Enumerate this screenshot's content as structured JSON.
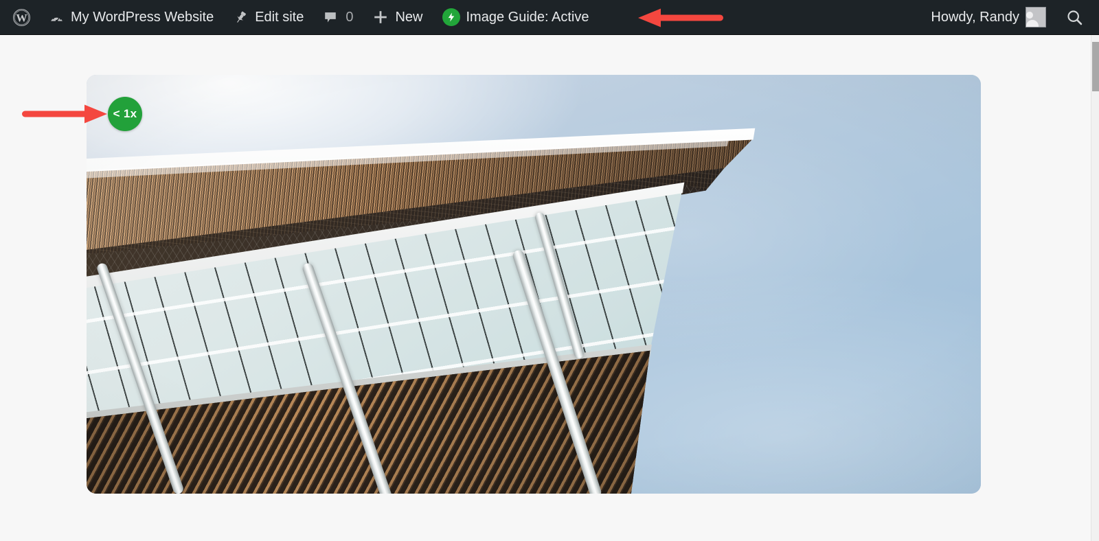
{
  "adminbar": {
    "wp_logo": "wordpress-logo",
    "items": [
      {
        "id": "site-name",
        "label": "My WordPress Website",
        "icon": "dashboard-gauge-icon"
      },
      {
        "id": "edit-site",
        "label": "Edit site",
        "icon": "pushpin-icon"
      },
      {
        "id": "comments",
        "label": "",
        "count": "0",
        "icon": "comment-bubble-icon"
      },
      {
        "id": "new-content",
        "label": "New",
        "icon": "plus-icon"
      },
      {
        "id": "image-guide",
        "label": "Image Guide: Active",
        "icon": "green-bolt-icon"
      }
    ],
    "account": {
      "greeting": "Howdy, Randy",
      "avatar": "user-avatar-placeholder"
    },
    "search": {
      "icon": "search-icon",
      "label": "Search"
    }
  },
  "page": {
    "background_color": "#f7f7f7"
  },
  "photo": {
    "name": "building-facade-photo",
    "alt": "Modern building with wooden slat facade and glass canopy seen from below against a blue sky",
    "corner_radius": "14px"
  },
  "badge": {
    "label": "< 1x",
    "color": "#22a13a",
    "text_color": "#ffffff",
    "meaning": "image-scale-indicator"
  },
  "annotations": [
    {
      "id": "arrow-to-badge",
      "direction": "right",
      "color": "#f4473f",
      "target": "size-badge"
    },
    {
      "id": "arrow-to-image-guide",
      "direction": "left",
      "color": "#f4473f",
      "target": "image-guide-menu-item"
    }
  ],
  "scrollbar": {
    "orientation": "vertical",
    "thumb_color": "#a8a8a8"
  }
}
